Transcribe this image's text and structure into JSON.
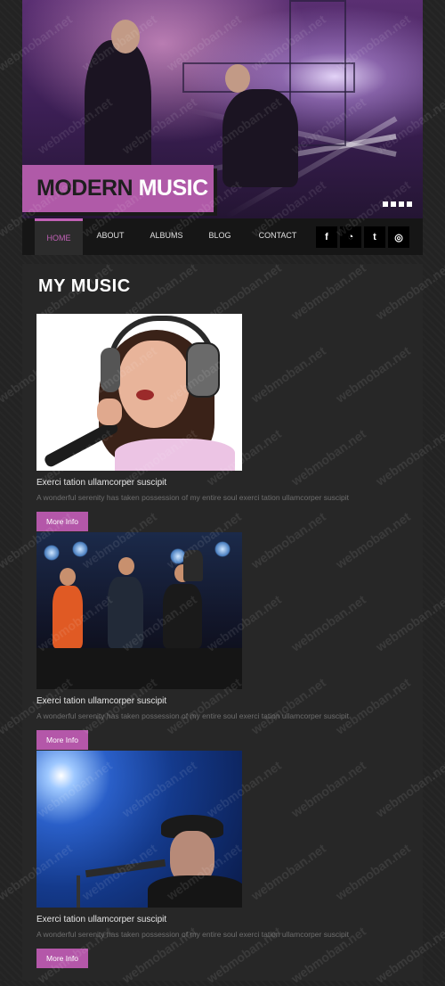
{
  "hero": {
    "title_dark": "MODERN",
    "title_light": "MUSIC",
    "slider_dots": 4
  },
  "nav": {
    "items": [
      {
        "label": "HOME",
        "active": true
      },
      {
        "label": "ABOUT",
        "active": false
      },
      {
        "label": "ALBUMS",
        "active": false
      },
      {
        "label": "BLOG",
        "active": false
      },
      {
        "label": "CONTACT",
        "active": false
      }
    ],
    "social": [
      {
        "icon": "facebook-icon",
        "glyph": "f"
      },
      {
        "icon": "rss-icon",
        "glyph": "◔"
      },
      {
        "icon": "twitter-icon",
        "glyph": "t"
      },
      {
        "icon": "dribbble-icon",
        "glyph": "◎"
      }
    ]
  },
  "content": {
    "section_title": "MY MUSIC",
    "items": [
      {
        "title": "Exerci tation ullamcorper suscipit",
        "description": "A wonderful serenity has taken possession of my entire soul exerci tation ullamcorper suscipit",
        "button": "More Info"
      },
      {
        "title": "Exerci tation ullamcorper suscipit",
        "description": "A wonderful serenity has taken possession of my entire soul exerci tation ullamcorper suscipit",
        "button": "More Info"
      },
      {
        "title": "Exerci tation ullamcorper suscipit",
        "description": "A wonderful serenity has taken possession of my entire soul exerci tation ullamcorper suscipit",
        "button": "More Info"
      }
    ]
  },
  "watermark": "webmoban.net",
  "colors": {
    "accent": "#b457a9",
    "background": "#232323",
    "panel": "#272727",
    "nav": "#161616"
  }
}
